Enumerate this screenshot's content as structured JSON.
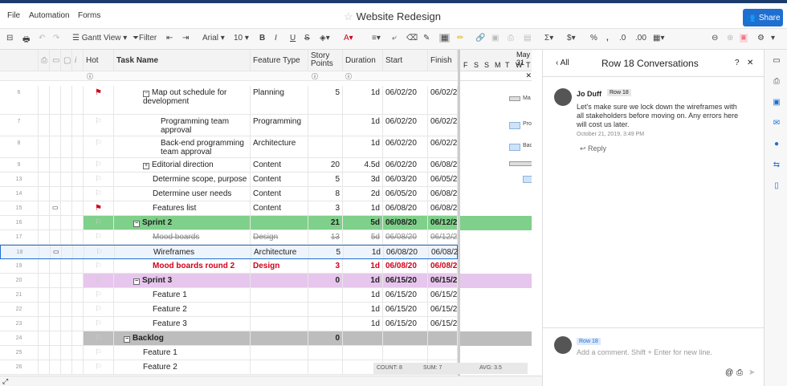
{
  "menu": {
    "file": "File",
    "automation": "Automation",
    "forms": "Forms"
  },
  "title": "Website Redesign",
  "share_label": "Share",
  "toolbar": {
    "gantt_view": "Gantt View",
    "filter": "Filter",
    "font": "Arial",
    "font_size": "10",
    "sigma": "Σ",
    "dollar": "$",
    "percent": "%",
    "comma": ","
  },
  "columns": {
    "hot": "Hot",
    "task_name": "Task Name",
    "feature_type": "Feature Type",
    "story_points": "Story Points",
    "duration": "Duration",
    "start": "Start",
    "finish": "Finish"
  },
  "gantt": {
    "month_label": "May 31",
    "days": [
      "F",
      "S",
      "S",
      "M",
      "T",
      "W",
      "T"
    ]
  },
  "rows": [
    {
      "n": "6",
      "task": "Map out schedule for development",
      "type": "Planning",
      "sp": "5",
      "dur": "1d",
      "start": "06/02/20",
      "finish": "06/02/2",
      "flag": "red"
    },
    {
      "n": "7",
      "task": "Programming team approval",
      "type": "Programming",
      "sp": "",
      "dur": "1d",
      "start": "06/02/20",
      "finish": "06/02/2"
    },
    {
      "n": "8",
      "task": "Back-end programming team approval",
      "type": "Architecture",
      "sp": "",
      "dur": "1d",
      "start": "06/02/20",
      "finish": "06/02/2"
    },
    {
      "n": "9",
      "task": "Editorial direction",
      "type": "Content",
      "sp": "20",
      "dur": "4.5d",
      "start": "06/02/20",
      "finish": "06/08/2"
    },
    {
      "n": "13",
      "task": "Determine scope, purpose",
      "type": "Content",
      "sp": "5",
      "dur": "3d",
      "start": "06/03/20",
      "finish": "06/05/2"
    },
    {
      "n": "14",
      "task": "Determine user needs",
      "type": "Content",
      "sp": "8",
      "dur": "2d",
      "start": "06/05/20",
      "finish": "06/08/2"
    },
    {
      "n": "15",
      "task": "Features list",
      "type": "Content",
      "sp": "3",
      "dur": "1d",
      "start": "06/08/20",
      "finish": "06/08/2",
      "flag": "red"
    },
    {
      "n": "16",
      "task": "Sprint 2",
      "type": "",
      "sp": "21",
      "dur": "5d",
      "start": "06/08/20",
      "finish": "06/12/2"
    },
    {
      "n": "17",
      "task": "Mood boards",
      "type": "Design",
      "sp": "13",
      "dur": "5d",
      "start": "06/08/20",
      "finish": "06/12/2"
    },
    {
      "n": "18",
      "task": "Wireframes",
      "type": "Architecture",
      "sp": "5",
      "dur": "1d",
      "start": "06/08/20",
      "finish": "06/08/2"
    },
    {
      "n": "19",
      "task": "Mood boards round 2",
      "type": "Design",
      "sp": "3",
      "dur": "1d",
      "start": "06/08/20",
      "finish": "06/08/2"
    },
    {
      "n": "20",
      "task": "Sprint 3",
      "type": "",
      "sp": "0",
      "dur": "1d",
      "start": "06/15/20",
      "finish": "06/15/2"
    },
    {
      "n": "21",
      "task": "Feature 1",
      "type": "",
      "sp": "",
      "dur": "1d",
      "start": "06/15/20",
      "finish": "06/15/2"
    },
    {
      "n": "22",
      "task": "Feature 2",
      "type": "",
      "sp": "",
      "dur": "1d",
      "start": "06/15/20",
      "finish": "06/15/2"
    },
    {
      "n": "23",
      "task": "Feature 3",
      "type": "",
      "sp": "",
      "dur": "1d",
      "start": "06/15/20",
      "finish": "06/15/2"
    },
    {
      "n": "24",
      "task": "Backlog",
      "type": "",
      "sp": "0",
      "dur": "",
      "start": "",
      "finish": ""
    },
    {
      "n": "25",
      "task": "Feature 1",
      "type": "",
      "sp": "",
      "dur": "",
      "start": "",
      "finish": ""
    },
    {
      "n": "26",
      "task": "Feature 2",
      "type": "",
      "sp": "",
      "dur": "",
      "start": "",
      "finish": ""
    }
  ],
  "gantt_labels": [
    "Ma",
    "Pro",
    "Bac"
  ],
  "stats": {
    "count": "COUNT: 8",
    "sum": "SUM: 7",
    "avg": "AVG: 3.5"
  },
  "panel": {
    "back": "All",
    "title": "Row 18 Conversations",
    "help": "?",
    "author": "Jo Duff",
    "row_tag": "Row 18",
    "message": "Let's make sure we lock down the wireframes with all stakeholders before moving on. Any errors here will cost us later.",
    "timestamp": "October 21, 2019, 3:49 PM",
    "reply": "Reply",
    "compose_tag": "Row 18",
    "compose_placeholder": "Add a comment. Shift + Enter for new line."
  },
  "colors": {
    "accent": "#1f6fd1",
    "sprint2": "#7fd08a",
    "sprint3": "#e6c6ec",
    "backlog": "#bdbdbd",
    "flag": "#d0021b"
  }
}
